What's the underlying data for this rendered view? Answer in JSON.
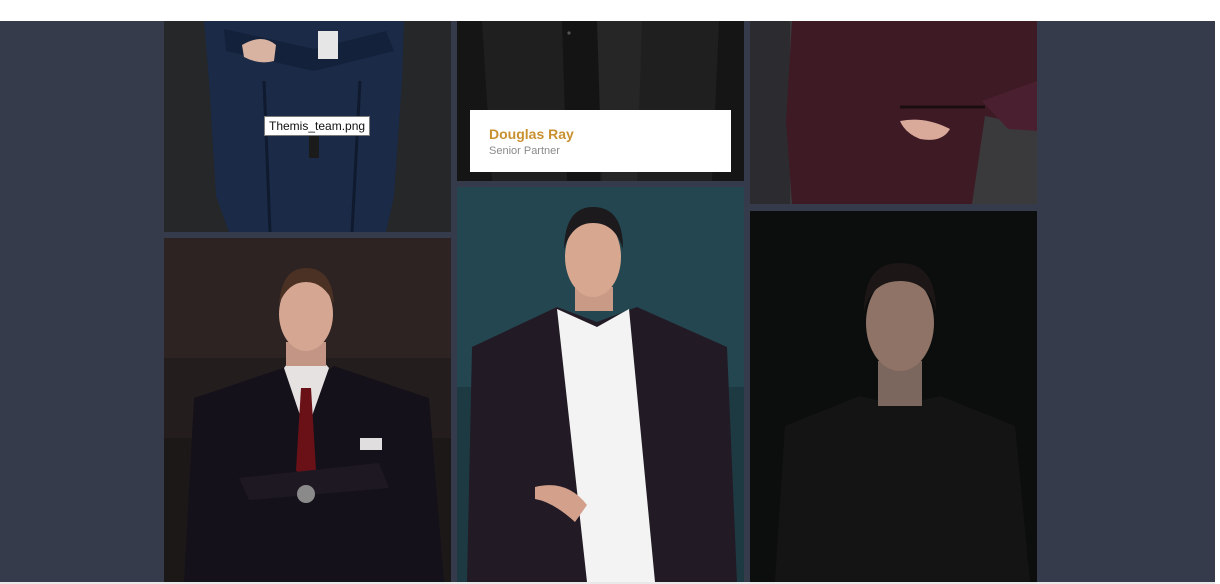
{
  "tooltip": {
    "text": "Themis_team.png"
  },
  "featured_member": {
    "name": "Douglas Ray",
    "role": "Senior Partner"
  },
  "colors": {
    "page_background": "#353b4a",
    "name_accent": "#c9902f",
    "role_text": "#8a8a8a"
  },
  "tiles": [
    {
      "subject": "person-in-navy-suit-arms-crossed"
    },
    {
      "subject": "person-in-black-suit"
    },
    {
      "subject": "person-in-burgundy-dress-hand-on-hip"
    },
    {
      "subject": "man-in-dark-suit-red-tie-arms-crossed"
    },
    {
      "subject": "man-in-dark-blazer-white-shirt"
    },
    {
      "subject": "man-in-black-tshirt"
    }
  ]
}
